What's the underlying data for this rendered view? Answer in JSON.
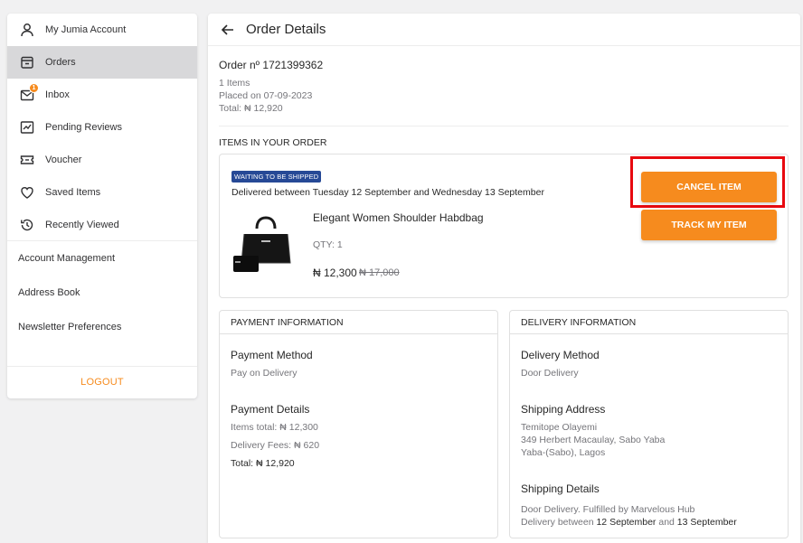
{
  "sidebar": {
    "items": [
      {
        "label": "My Jumia Account",
        "icon": "user-icon"
      },
      {
        "label": "Orders",
        "icon": "orders-icon"
      },
      {
        "label": "Inbox",
        "icon": "inbox-icon",
        "badge": "1"
      },
      {
        "label": "Pending Reviews",
        "icon": "review-icon"
      },
      {
        "label": "Voucher",
        "icon": "voucher-icon"
      },
      {
        "label": "Saved Items",
        "icon": "heart-icon"
      },
      {
        "label": "Recently Viewed",
        "icon": "history-icon"
      }
    ],
    "links": [
      {
        "label": "Account Management"
      },
      {
        "label": "Address Book"
      },
      {
        "label": "Newsletter Preferences"
      }
    ],
    "logout_label": "LOGOUT"
  },
  "header": {
    "title": "Order Details"
  },
  "order": {
    "number_label": "Order nº 1721399362",
    "items_count": "1 Items",
    "placed_on": "Placed on 07-09-2023",
    "total": "Total: ₦ 12,920"
  },
  "items_section": {
    "heading": "ITEMS IN YOUR ORDER",
    "status": "WAITING TO BE SHIPPED",
    "delivery_window": "Delivered between Tuesday 12 September and Wednesday 13 September",
    "product_name": "Elegant Women Shoulder Habdbag",
    "qty": "QTY: 1",
    "price": "₦ 12,300",
    "old_price": "₦ 17,000",
    "cancel_label": "CANCEL ITEM",
    "track_label": "TRACK MY ITEM"
  },
  "payment": {
    "title": "PAYMENT INFORMATION",
    "method_heading": "Payment Method",
    "method": "Pay on Delivery",
    "details_heading": "Payment Details",
    "items_total": "Items total: ₦ 12,300",
    "delivery_fees": "Delivery Fees: ₦ 620",
    "total": "Total: ₦ 12,920"
  },
  "delivery": {
    "title": "DELIVERY INFORMATION",
    "method_heading": "Delivery Method",
    "method": "Door Delivery",
    "address_heading": "Shipping Address",
    "address_name": "Temitope Olayemi",
    "address_line1": "349 Herbert Macaulay, Sabo Yaba",
    "address_line2": "Yaba-(Sabo), Lagos",
    "details_heading": "Shipping Details",
    "details_line1": "Door Delivery. Fulfilled by Marvelous Hub",
    "details_line2_prefix": "Delivery between ",
    "details_line2_date1": "12 September",
    "details_line2_mid": " and ",
    "details_line2_date2": "13 September"
  },
  "colors": {
    "accent": "#f68b1e",
    "status_tag": "#264996",
    "highlight": "#e8090f"
  }
}
